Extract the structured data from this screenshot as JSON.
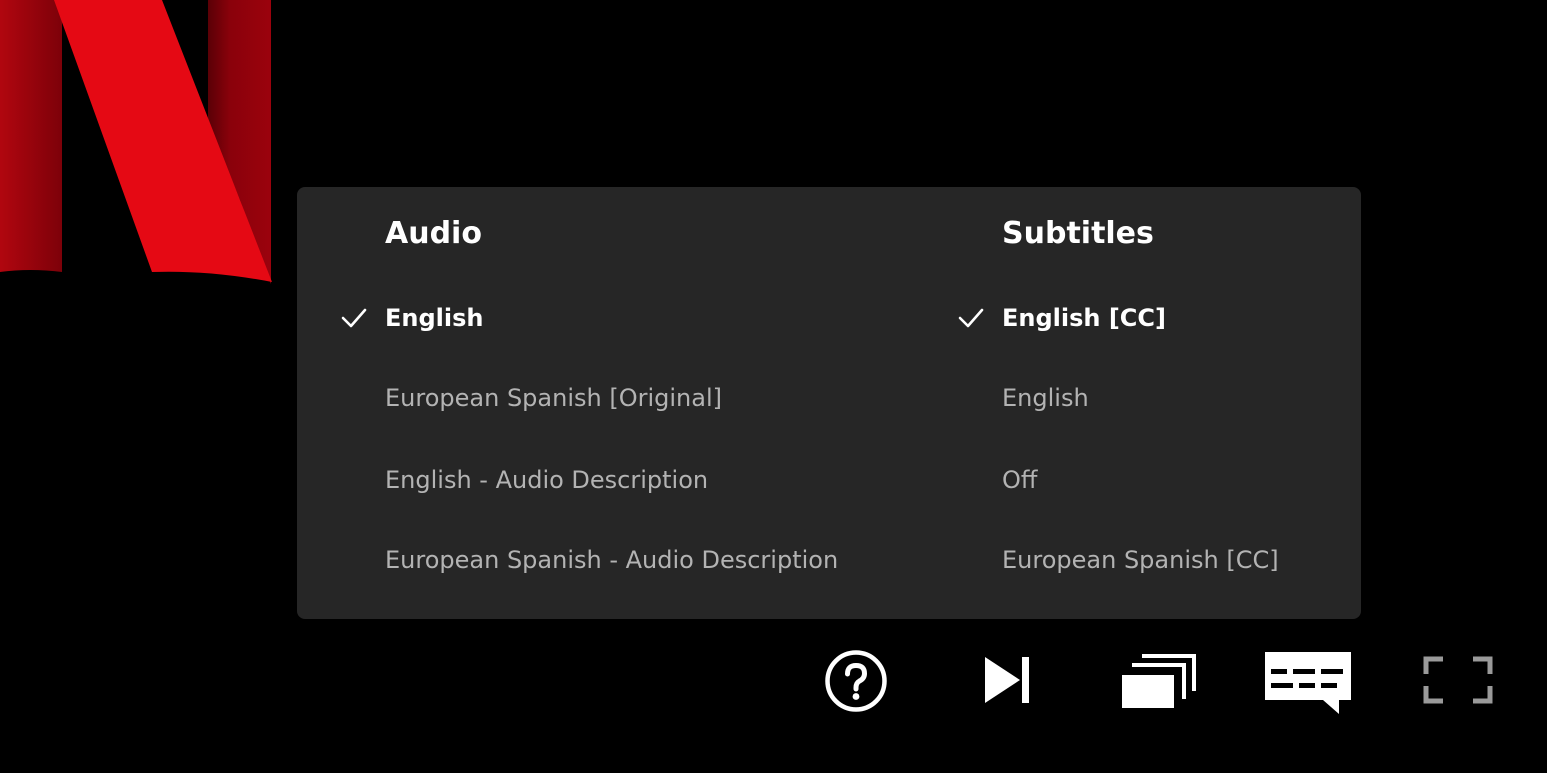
{
  "audio": {
    "title": "Audio",
    "options": [
      {
        "label": "English",
        "selected": true
      },
      {
        "label": "European Spanish [Original]",
        "selected": false
      },
      {
        "label": "English - Audio Description",
        "selected": false
      },
      {
        "label": "European Spanish - Audio Description",
        "selected": false
      }
    ]
  },
  "subtitles": {
    "title": "Subtitles",
    "options": [
      {
        "label": "English [CC]",
        "selected": true
      },
      {
        "label": "English",
        "selected": false
      },
      {
        "label": "Off",
        "selected": false
      },
      {
        "label": "European Spanish [CC]",
        "selected": false
      }
    ]
  },
  "controls": {
    "icons": [
      "help-icon",
      "next-episode-icon",
      "episodes-icon",
      "audio-subtitles-icon",
      "fullscreen-icon"
    ]
  },
  "colors": {
    "background": "#000000",
    "panel": "#262626",
    "selected_text": "#ffffff",
    "unselected_text": "#b3b3b3",
    "brand_red": "#e50914"
  }
}
